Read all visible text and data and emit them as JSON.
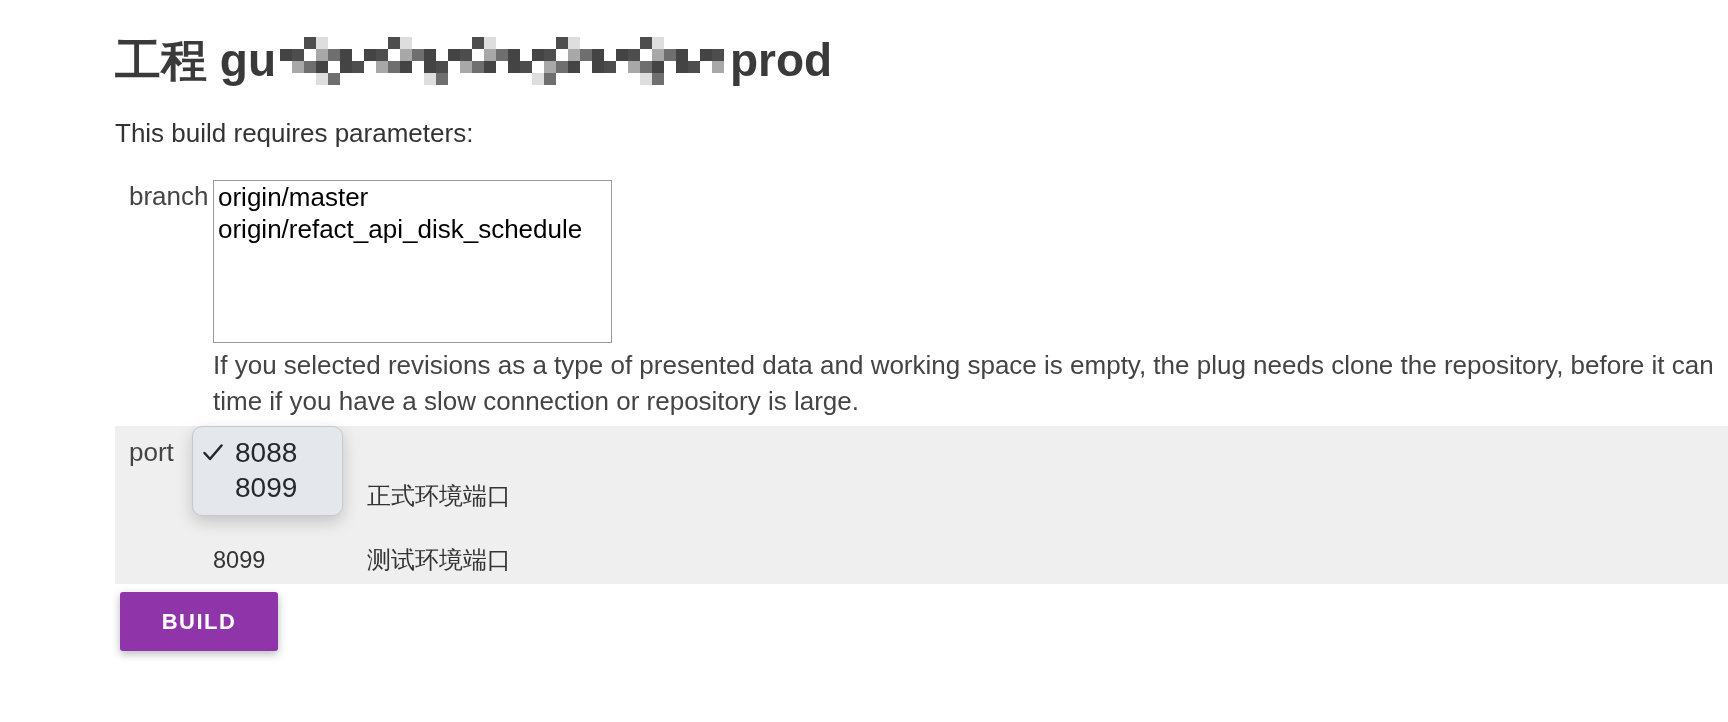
{
  "title": {
    "before_redaction": "工程 gu",
    "redacted": true,
    "after_redaction": "prod"
  },
  "intro": "This build requires parameters:",
  "parameters": [
    {
      "kind": "listbox",
      "name": "branch",
      "highlighted": false,
      "options": [
        {
          "label": "origin/master",
          "selected": false
        },
        {
          "label": "origin/refact_api_disk_schedule",
          "selected": false
        }
      ],
      "help_lines": [
        "If you selected revisions as a type of presented data and working space is empty, the plug needs clone the repository, before it can",
        "time if you have a slow connection or repository is large."
      ]
    },
    {
      "kind": "dropdown",
      "name": "port",
      "highlighted": true,
      "expanded": true,
      "options": [
        {
          "label": "8088",
          "selected": true
        },
        {
          "label": "8099",
          "selected": false
        }
      ],
      "description_rows": [
        {
          "description": "正式环境端口"
        },
        {
          "value": "8099",
          "description": "测试环境端口"
        }
      ]
    }
  ],
  "build_button": {
    "label": "BUILD"
  }
}
